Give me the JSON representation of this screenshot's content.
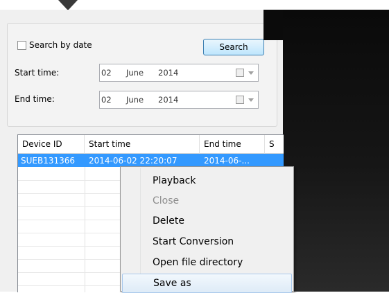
{
  "search": {
    "checkbox_label": "Search by date",
    "button_label": "Search",
    "start_label": "Start time:",
    "end_label": "End time:",
    "start": {
      "day": "02",
      "month": "June",
      "year": "2014"
    },
    "end": {
      "day": "02",
      "month": "June",
      "year": "2014"
    }
  },
  "table": {
    "headers": [
      "Device ID",
      "Start time",
      "End time",
      "S"
    ],
    "rows": [
      {
        "device_id": "SUEB131366",
        "start_time": "2014-06-02 22:20:07",
        "end_time": "2014-06-..."
      }
    ]
  },
  "context_menu": {
    "items": [
      {
        "label": "Playback"
      },
      {
        "label": "Close"
      },
      {
        "label": "Delete"
      },
      {
        "label": "Start Conversion"
      },
      {
        "label": "Open file directory"
      },
      {
        "label": "Save as"
      }
    ]
  },
  "colors": {
    "selection": "#3399ff",
    "panel": "#f0f0f0",
    "video": "#0a0a0a"
  }
}
